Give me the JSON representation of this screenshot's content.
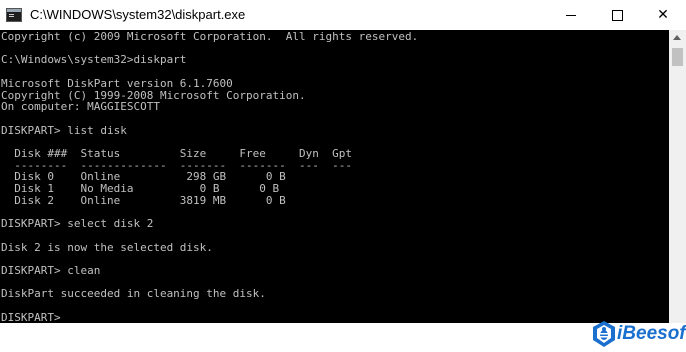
{
  "window": {
    "title": "C:\\WINDOWS\\system32\\diskpart.exe",
    "minimize_glyph": "minimize-icon",
    "maximize_glyph": "maximize-icon",
    "close_glyph": "✕"
  },
  "console": {
    "text": "Copyright (c) 2009 Microsoft Corporation.  All rights reserved.\n\nC:\\Windows\\system32>diskpart\n\nMicrosoft DiskPart version 6.1.7600\nCopyright (C) 1999-2008 Microsoft Corporation.\nOn computer: MAGGIESCOTT\n\nDISKPART> list disk\n\n  Disk ###  Status         Size     Free     Dyn  Gpt\n  --------  -------------  -------  -------  ---  ---\n  Disk 0    Online          298 GB      0 B\n  Disk 1    No Media          0 B      0 B\n  Disk 2    Online         3819 MB      0 B\n\nDISKPART> select disk 2\n\nDisk 2 is now the selected disk.\n\nDISKPART> clean\n\nDiskPart succeeded in cleaning the disk.\n\nDISKPART> "
  },
  "watermark": {
    "text": "iBeesoft",
    "color": "#1a6fcf"
  },
  "colors": {
    "console_bg": "#000000",
    "console_fg": "#c0c0c0",
    "titlebar_bg": "#ffffff"
  }
}
